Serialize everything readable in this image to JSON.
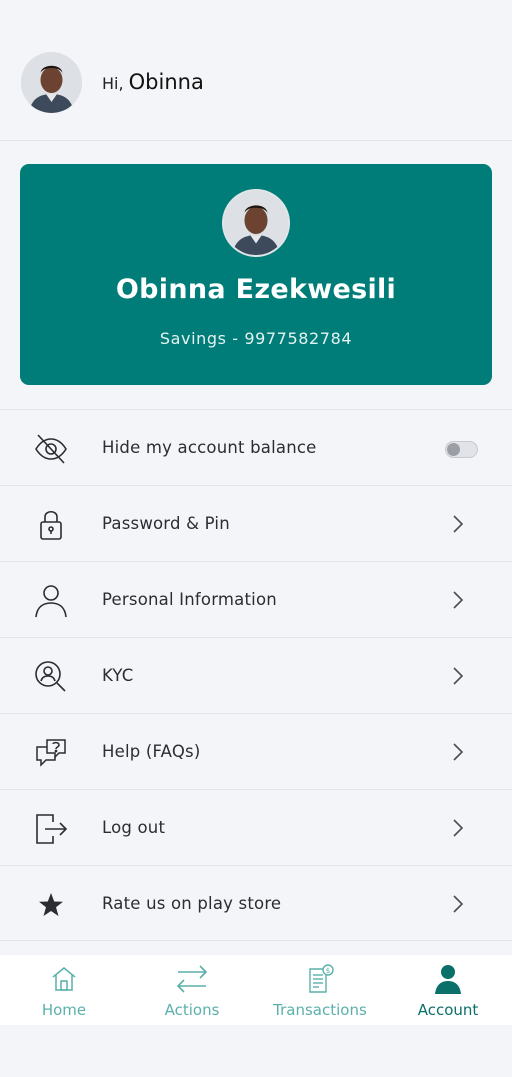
{
  "header": {
    "greeting": "Hi,",
    "first_name": "Obinna"
  },
  "card": {
    "full_name": "Obinna Ezekwesili",
    "account_line": "Savings - 9977582784",
    "background": "#007d78"
  },
  "menu": {
    "items": [
      {
        "label": "Hide my account balance",
        "icon": "eye-off-icon",
        "control": "toggle",
        "toggle_on": false
      },
      {
        "label": "Password & Pin",
        "icon": "lock-icon",
        "control": "chevron"
      },
      {
        "label": "Personal Information",
        "icon": "user-icon",
        "control": "chevron"
      },
      {
        "label": "KYC",
        "icon": "user-search-icon",
        "control": "chevron"
      },
      {
        "label": "Help (FAQs)",
        "icon": "chat-question-icon",
        "control": "chevron"
      },
      {
        "label": "Log out",
        "icon": "logout-icon",
        "control": "chevron"
      },
      {
        "label": "Rate us on play store",
        "icon": "star-icon",
        "control": "chevron"
      }
    ]
  },
  "tabbar": {
    "tabs": [
      {
        "label": "Home",
        "icon": "home-icon",
        "active": false
      },
      {
        "label": "Actions",
        "icon": "swap-arrows-icon",
        "active": false
      },
      {
        "label": "Transactions",
        "icon": "receipt-icon",
        "active": false
      },
      {
        "label": "Account",
        "icon": "account-icon",
        "active": true
      }
    ],
    "active_color": "#0b6f6a",
    "inactive_color": "#5bb0ab"
  }
}
